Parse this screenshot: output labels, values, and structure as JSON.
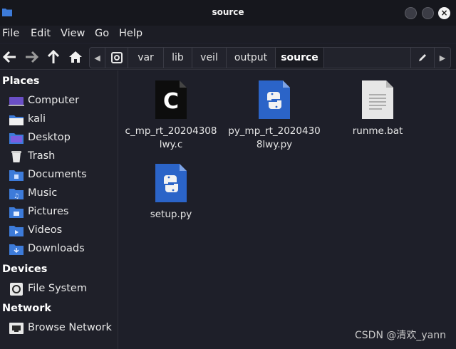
{
  "window": {
    "title": "source"
  },
  "menubar": {
    "items": [
      "File",
      "Edit",
      "View",
      "Go",
      "Help"
    ]
  },
  "pathbar": {
    "crumbs": [
      "var",
      "lib",
      "veil",
      "output",
      "source"
    ]
  },
  "sidebar": {
    "places_heading": "Places",
    "places": [
      {
        "label": "Computer",
        "icon": "computer-icon"
      },
      {
        "label": "kali",
        "icon": "home-folder-icon"
      },
      {
        "label": "Desktop",
        "icon": "desktop-folder-icon"
      },
      {
        "label": "Trash",
        "icon": "trash-icon"
      },
      {
        "label": "Documents",
        "icon": "documents-folder-icon"
      },
      {
        "label": "Music",
        "icon": "music-folder-icon"
      },
      {
        "label": "Pictures",
        "icon": "pictures-folder-icon"
      },
      {
        "label": "Videos",
        "icon": "videos-folder-icon"
      },
      {
        "label": "Downloads",
        "icon": "downloads-folder-icon"
      }
    ],
    "devices_heading": "Devices",
    "devices": [
      {
        "label": "File System",
        "icon": "drive-icon"
      }
    ],
    "network_heading": "Network",
    "network": [
      {
        "label": "Browse Network",
        "icon": "network-icon"
      }
    ]
  },
  "files": [
    {
      "line1": "c_mp_rt_20204308",
      "line2": "lwy.c",
      "icon": "c-source-file-icon"
    },
    {
      "line1": "py_mp_rt_2020430",
      "line2": "8lwy.py",
      "icon": "python-file-icon"
    },
    {
      "line1": "runme.bat",
      "line2": "",
      "icon": "text-file-icon"
    },
    {
      "line1": "setup.py",
      "line2": "",
      "icon": "python-file-icon"
    }
  ],
  "watermark": "CSDN @清欢_yann",
  "colors": {
    "folder_blue": "#3d7bd9",
    "background": "#1e1f29",
    "python_blue": "#2b64c8"
  }
}
